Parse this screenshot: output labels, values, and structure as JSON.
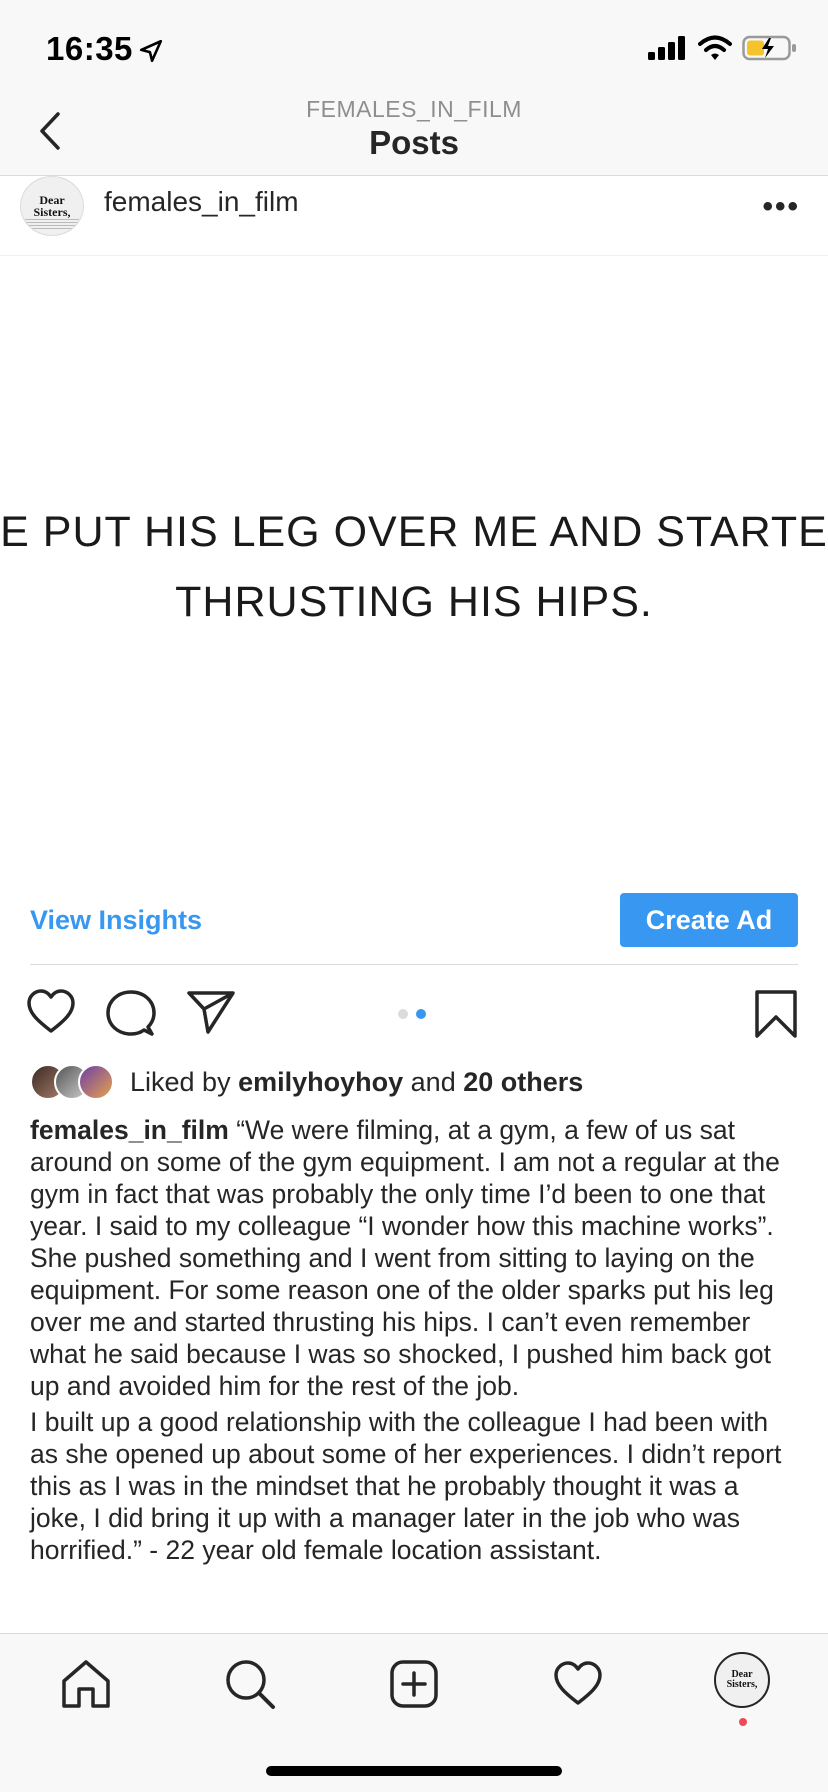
{
  "status_bar": {
    "time": "16:35"
  },
  "nav": {
    "subtitle": "FEMALES_IN_FILM",
    "title": "Posts"
  },
  "post": {
    "avatar_text_1": "Dear",
    "avatar_text_2": "Sisters,",
    "username": "females_in_film",
    "more_label": "•••",
    "image_quote_line_1": "HE PUT HIS LEG OVER ME AND STARTED",
    "image_quote_line_2": "THRUSTING HIS HIPS.",
    "carousel_total": 2,
    "carousel_active": 2
  },
  "insights": {
    "view_insights_label": "View Insights",
    "create_ad_label": "Create Ad"
  },
  "likes": {
    "prefix": "Liked by",
    "user": "emilyhoyhoy",
    "conjunction": "and",
    "others": "20 others"
  },
  "caption": {
    "username": "females_in_film",
    "paragraph_1": "“We were filming, at a gym, a few of us sat around on some of the gym equipment. I am not a regular at the gym in fact that was probably the only time I’d been to one that year. I said to my colleague “I wonder how this machine works”. She pushed something and I went from sitting to laying on the equipment. For some reason one of the older sparks put his leg over me and started thrusting his hips. I can’t even remember what he said because I was so shocked, I pushed him back got up and avoided him for the rest of the job.",
    "paragraph_2": "I built up a good relationship with the colleague I had been with as she opened up about some of her experiences. I didn’t report this as I was in the mindset that he probably thought it was a joke, I did bring it up with a manager later in the job who was horrified.” - 22 year old female location assistant."
  },
  "tab_bar": {
    "items": [
      "home-icon",
      "search-icon",
      "new-post-icon",
      "activity-icon",
      "profile-avatar"
    ],
    "profile_text_1": "Dear",
    "profile_text_2": "Sisters,"
  },
  "colors": {
    "accent": "#3897f0",
    "text": "#262626",
    "secondary": "#8e8e8e",
    "notification": "#ed4956"
  }
}
